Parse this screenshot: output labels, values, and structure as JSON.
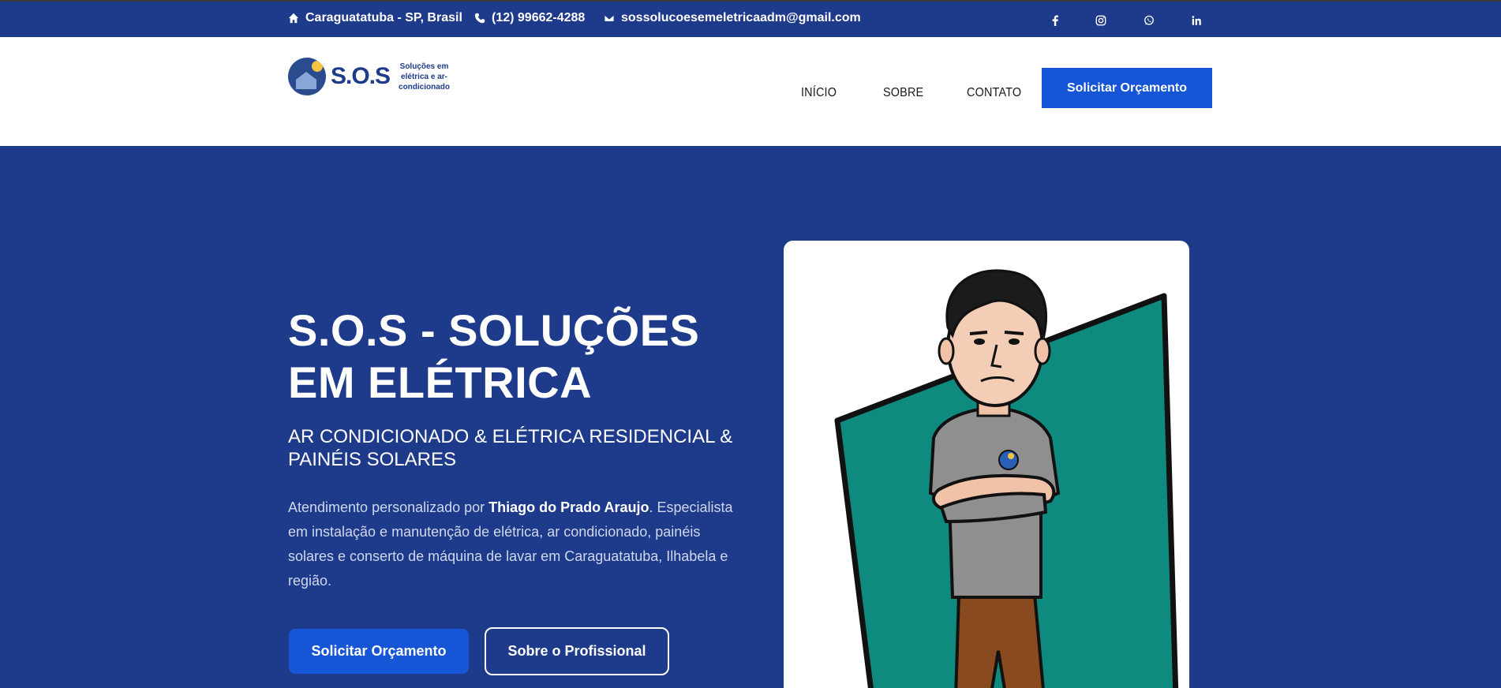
{
  "topbar": {
    "address": "Caraguatatuba - SP, Brasil",
    "phone": "(12) 99662-4288",
    "email": "sossolucoesemeletricaadm@gmail.com",
    "social": [
      "facebook-icon",
      "instagram-icon",
      "whatsapp-icon",
      "linkedin-icon"
    ]
  },
  "logo": {
    "mark": "S.O.S",
    "tagline": "Soluções em elétrica e ar-condicionado"
  },
  "nav": {
    "items": [
      "INÍCIO",
      "SOBRE",
      "CONTATO"
    ],
    "cta": "Solicitar Orçamento"
  },
  "hero": {
    "title": "S.O.S - SOLUÇÕES EM ELÉTRICA",
    "subtitle": "AR CONDICIONADO & ELÉTRICA RESIDENCIAL & PAINÉIS SOLARES",
    "desc_prefix": "Atendimento personalizado por ",
    "desc_name": "Thiago do Prado Araujo",
    "desc_suffix": ". Especialista em instalação e manutenção de elétrica, ar condicionado, painéis solares e conserto de máquina de lavar em Caraguatatuba, Ilhabela e região.",
    "primary_button": "Solicitar Orçamento",
    "secondary_button": "Sobre o Profissional"
  },
  "colors": {
    "brand": "#1e3a8a",
    "accent": "#1656d6",
    "card_green": "#0f8a7e"
  }
}
